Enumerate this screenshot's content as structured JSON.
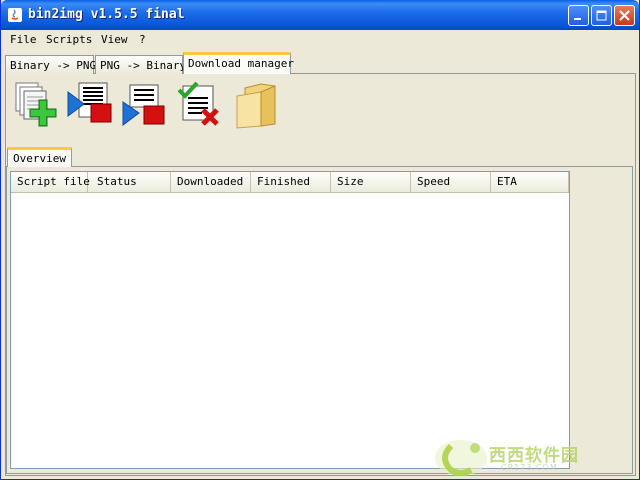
{
  "window": {
    "title": "bin2img v1.5.5 final"
  },
  "menu": [
    {
      "label": "File"
    },
    {
      "label": "Scripts"
    },
    {
      "label": "View"
    },
    {
      "label": "?"
    }
  ],
  "tabs": [
    {
      "label": "Binary -> PNG"
    },
    {
      "label": "PNG -> Binary"
    },
    {
      "label": "Download manager",
      "active": true
    }
  ],
  "toolbar": {
    "icons": [
      "add-documents-icon",
      "start-download-icon",
      "stop-download-icon",
      "remove-finished-icon",
      "open-folder-icon"
    ]
  },
  "inner_tabs": [
    {
      "label": "Overview"
    }
  ],
  "table": {
    "columns": [
      "Script file",
      "Status",
      "Downloaded",
      "Finished",
      "Size",
      "Speed",
      "ETA"
    ],
    "rows": []
  },
  "watermark": {
    "text": "西西软件园",
    "url": "CR173.COM"
  },
  "colors": {
    "titlebar": "#0b58dc",
    "accent_tab": "#ffc83c",
    "background": "#ece9d8"
  }
}
